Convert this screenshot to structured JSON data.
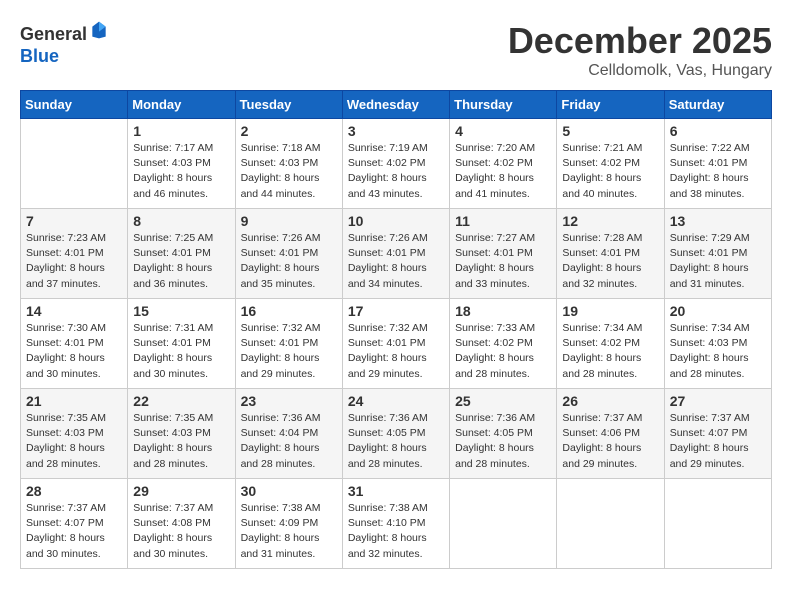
{
  "header": {
    "logo_line1": "General",
    "logo_line2": "Blue",
    "month": "December 2025",
    "location": "Celldomolk, Vas, Hungary"
  },
  "columns": [
    "Sunday",
    "Monday",
    "Tuesday",
    "Wednesday",
    "Thursday",
    "Friday",
    "Saturday"
  ],
  "weeks": [
    [
      {
        "day": "",
        "sunrise": "",
        "sunset": "",
        "daylight": ""
      },
      {
        "day": "1",
        "sunrise": "Sunrise: 7:17 AM",
        "sunset": "Sunset: 4:03 PM",
        "daylight": "Daylight: 8 hours and 46 minutes."
      },
      {
        "day": "2",
        "sunrise": "Sunrise: 7:18 AM",
        "sunset": "Sunset: 4:03 PM",
        "daylight": "Daylight: 8 hours and 44 minutes."
      },
      {
        "day": "3",
        "sunrise": "Sunrise: 7:19 AM",
        "sunset": "Sunset: 4:02 PM",
        "daylight": "Daylight: 8 hours and 43 minutes."
      },
      {
        "day": "4",
        "sunrise": "Sunrise: 7:20 AM",
        "sunset": "Sunset: 4:02 PM",
        "daylight": "Daylight: 8 hours and 41 minutes."
      },
      {
        "day": "5",
        "sunrise": "Sunrise: 7:21 AM",
        "sunset": "Sunset: 4:02 PM",
        "daylight": "Daylight: 8 hours and 40 minutes."
      },
      {
        "day": "6",
        "sunrise": "Sunrise: 7:22 AM",
        "sunset": "Sunset: 4:01 PM",
        "daylight": "Daylight: 8 hours and 38 minutes."
      }
    ],
    [
      {
        "day": "7",
        "sunrise": "Sunrise: 7:23 AM",
        "sunset": "Sunset: 4:01 PM",
        "daylight": "Daylight: 8 hours and 37 minutes."
      },
      {
        "day": "8",
        "sunrise": "Sunrise: 7:25 AM",
        "sunset": "Sunset: 4:01 PM",
        "daylight": "Daylight: 8 hours and 36 minutes."
      },
      {
        "day": "9",
        "sunrise": "Sunrise: 7:26 AM",
        "sunset": "Sunset: 4:01 PM",
        "daylight": "Daylight: 8 hours and 35 minutes."
      },
      {
        "day": "10",
        "sunrise": "Sunrise: 7:26 AM",
        "sunset": "Sunset: 4:01 PM",
        "daylight": "Daylight: 8 hours and 34 minutes."
      },
      {
        "day": "11",
        "sunrise": "Sunrise: 7:27 AM",
        "sunset": "Sunset: 4:01 PM",
        "daylight": "Daylight: 8 hours and 33 minutes."
      },
      {
        "day": "12",
        "sunrise": "Sunrise: 7:28 AM",
        "sunset": "Sunset: 4:01 PM",
        "daylight": "Daylight: 8 hours and 32 minutes."
      },
      {
        "day": "13",
        "sunrise": "Sunrise: 7:29 AM",
        "sunset": "Sunset: 4:01 PM",
        "daylight": "Daylight: 8 hours and 31 minutes."
      }
    ],
    [
      {
        "day": "14",
        "sunrise": "Sunrise: 7:30 AM",
        "sunset": "Sunset: 4:01 PM",
        "daylight": "Daylight: 8 hours and 30 minutes."
      },
      {
        "day": "15",
        "sunrise": "Sunrise: 7:31 AM",
        "sunset": "Sunset: 4:01 PM",
        "daylight": "Daylight: 8 hours and 30 minutes."
      },
      {
        "day": "16",
        "sunrise": "Sunrise: 7:32 AM",
        "sunset": "Sunset: 4:01 PM",
        "daylight": "Daylight: 8 hours and 29 minutes."
      },
      {
        "day": "17",
        "sunrise": "Sunrise: 7:32 AM",
        "sunset": "Sunset: 4:01 PM",
        "daylight": "Daylight: 8 hours and 29 minutes."
      },
      {
        "day": "18",
        "sunrise": "Sunrise: 7:33 AM",
        "sunset": "Sunset: 4:02 PM",
        "daylight": "Daylight: 8 hours and 28 minutes."
      },
      {
        "day": "19",
        "sunrise": "Sunrise: 7:34 AM",
        "sunset": "Sunset: 4:02 PM",
        "daylight": "Daylight: 8 hours and 28 minutes."
      },
      {
        "day": "20",
        "sunrise": "Sunrise: 7:34 AM",
        "sunset": "Sunset: 4:03 PM",
        "daylight": "Daylight: 8 hours and 28 minutes."
      }
    ],
    [
      {
        "day": "21",
        "sunrise": "Sunrise: 7:35 AM",
        "sunset": "Sunset: 4:03 PM",
        "daylight": "Daylight: 8 hours and 28 minutes."
      },
      {
        "day": "22",
        "sunrise": "Sunrise: 7:35 AM",
        "sunset": "Sunset: 4:03 PM",
        "daylight": "Daylight: 8 hours and 28 minutes."
      },
      {
        "day": "23",
        "sunrise": "Sunrise: 7:36 AM",
        "sunset": "Sunset: 4:04 PM",
        "daylight": "Daylight: 8 hours and 28 minutes."
      },
      {
        "day": "24",
        "sunrise": "Sunrise: 7:36 AM",
        "sunset": "Sunset: 4:05 PM",
        "daylight": "Daylight: 8 hours and 28 minutes."
      },
      {
        "day": "25",
        "sunrise": "Sunrise: 7:36 AM",
        "sunset": "Sunset: 4:05 PM",
        "daylight": "Daylight: 8 hours and 28 minutes."
      },
      {
        "day": "26",
        "sunrise": "Sunrise: 7:37 AM",
        "sunset": "Sunset: 4:06 PM",
        "daylight": "Daylight: 8 hours and 29 minutes."
      },
      {
        "day": "27",
        "sunrise": "Sunrise: 7:37 AM",
        "sunset": "Sunset: 4:07 PM",
        "daylight": "Daylight: 8 hours and 29 minutes."
      }
    ],
    [
      {
        "day": "28",
        "sunrise": "Sunrise: 7:37 AM",
        "sunset": "Sunset: 4:07 PM",
        "daylight": "Daylight: 8 hours and 30 minutes."
      },
      {
        "day": "29",
        "sunrise": "Sunrise: 7:37 AM",
        "sunset": "Sunset: 4:08 PM",
        "daylight": "Daylight: 8 hours and 30 minutes."
      },
      {
        "day": "30",
        "sunrise": "Sunrise: 7:38 AM",
        "sunset": "Sunset: 4:09 PM",
        "daylight": "Daylight: 8 hours and 31 minutes."
      },
      {
        "day": "31",
        "sunrise": "Sunrise: 7:38 AM",
        "sunset": "Sunset: 4:10 PM",
        "daylight": "Daylight: 8 hours and 32 minutes."
      },
      {
        "day": "",
        "sunrise": "",
        "sunset": "",
        "daylight": ""
      },
      {
        "day": "",
        "sunrise": "",
        "sunset": "",
        "daylight": ""
      },
      {
        "day": "",
        "sunrise": "",
        "sunset": "",
        "daylight": ""
      }
    ]
  ]
}
